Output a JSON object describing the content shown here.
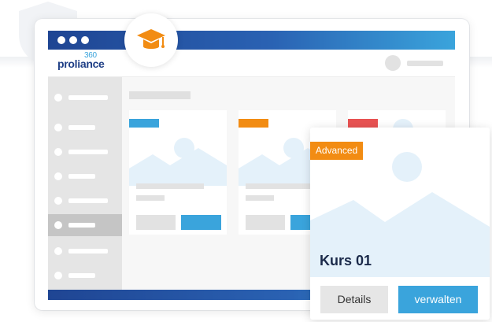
{
  "app": {
    "logo_text": "proliance",
    "logo_superscript": "360"
  },
  "icons": {
    "hero": "graduation-cap-icon",
    "background": "shield-icon"
  },
  "colors": {
    "brand_dark": "#1f4593",
    "brand_light": "#3aa4dc",
    "badge_orange": "#f28c13",
    "badge_red": "#e85252",
    "badge_blue": "#3aa4dc"
  },
  "course_card": {
    "badge": "Advanced",
    "title": "Kurs 01",
    "details_label": "Details",
    "manage_label": "verwalten"
  }
}
